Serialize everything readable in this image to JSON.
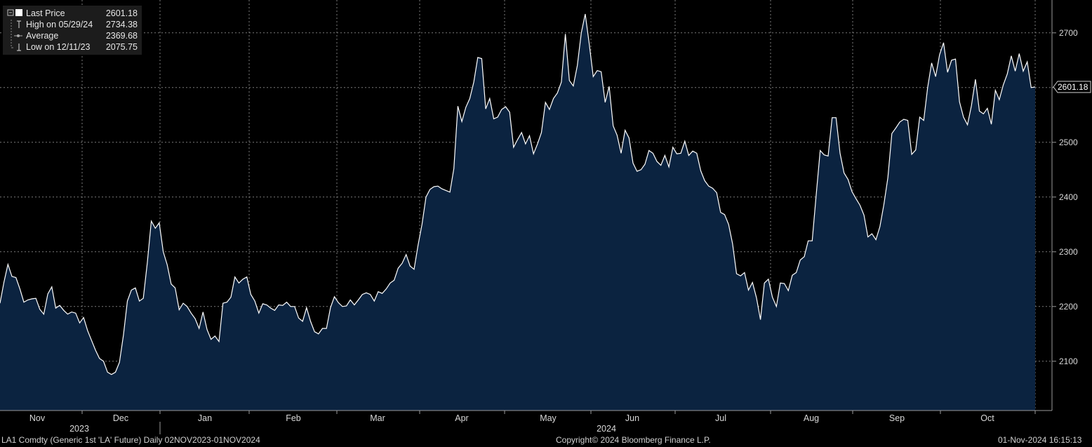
{
  "legend": {
    "rows": [
      {
        "label": "Last Price",
        "value": "2601.18"
      },
      {
        "label": "High on 05/29/24",
        "value": "2734.38"
      },
      {
        "label": "Average",
        "value": "2369.68"
      },
      {
        "label": "Low on 12/11/23",
        "value": "2075.75"
      }
    ]
  },
  "footer": {
    "left": "LA1 Comdty (Generic 1st 'LA' Future)  Daily 02NOV2023-01NOV2024",
    "center": "Copyright© 2024 Bloomberg Finance L.P.",
    "right": "01-Nov-2024 16:15:13"
  },
  "colors": {
    "background": "#000000",
    "area_fill": "#0b2340",
    "line": "#ffffff",
    "grid": "#7a7a7a",
    "legend_bg": "#1c1c1c"
  },
  "chart_data": {
    "type": "area",
    "ylim": [
      2010,
      2760
    ],
    "y_ticks": [
      2100,
      2200,
      2300,
      2400,
      2500,
      2600,
      2700
    ],
    "y_tick_labels": [
      "2100",
      "2200",
      "2300",
      "2400",
      "2500",
      "2600",
      "2700"
    ],
    "last_price_label": "2601.18",
    "last_price_value": 2601.18,
    "grid": true,
    "month_labels": [
      "Nov",
      "Dec",
      "Jan",
      "Feb",
      "Mar",
      "Apr",
      "May",
      "Jun",
      "Jul",
      "Aug",
      "Sep",
      "Oct"
    ],
    "year_labels": [
      "2023",
      "2024"
    ],
    "series": [
      {
        "values": [
          2206,
          2245,
          2277,
          2255,
          2253,
          2232,
          2208,
          2212,
          2214,
          2215,
          2195,
          2186,
          2223,
          2236,
          2197,
          2202,
          2193,
          2186,
          2190,
          2188,
          2170,
          2180,
          2156,
          2138,
          2120,
          2105,
          2100,
          2080,
          2075.75,
          2080,
          2098,
          2148,
          2210,
          2230,
          2234,
          2210,
          2215,
          2280,
          2356,
          2343,
          2353,
          2300,
          2276,
          2241,
          2234,
          2194,
          2206,
          2200,
          2188,
          2178,
          2160,
          2190,
          2158,
          2140,
          2146,
          2136,
          2206,
          2208,
          2217,
          2254,
          2243,
          2250,
          2254,
          2222,
          2210,
          2188,
          2205,
          2203,
          2197,
          2193,
          2203,
          2202,
          2208,
          2200,
          2200,
          2179,
          2173,
          2198,
          2173,
          2154,
          2150,
          2160,
          2160,
          2198,
          2218,
          2207,
          2200,
          2201,
          2212,
          2203,
          2212,
          2222,
          2225,
          2222,
          2210,
          2227,
          2224,
          2232,
          2243,
          2248,
          2270,
          2279,
          2295,
          2274,
          2268,
          2312,
          2350,
          2400,
          2414,
          2419,
          2420,
          2415,
          2412,
          2409,
          2452,
          2566,
          2538,
          2564,
          2580,
          2610,
          2655,
          2653,
          2561,
          2580,
          2543,
          2546,
          2560,
          2565,
          2555,
          2491,
          2505,
          2518,
          2497,
          2512,
          2479,
          2497,
          2518,
          2573,
          2560,
          2580,
          2590,
          2610,
          2698,
          2613,
          2603,
          2640,
          2700,
          2734.38,
          2680,
          2620,
          2631,
          2629,
          2573,
          2602,
          2530,
          2513,
          2480,
          2522,
          2508,
          2462,
          2447,
          2450,
          2460,
          2485,
          2480,
          2465,
          2458,
          2476,
          2455,
          2491,
          2479,
          2480,
          2502,
          2476,
          2484,
          2480,
          2448,
          2430,
          2420,
          2416,
          2408,
          2372,
          2368,
          2350,
          2315,
          2260,
          2256,
          2262,
          2230,
          2244,
          2216,
          2176,
          2243,
          2250,
          2217,
          2200,
          2243,
          2242,
          2229,
          2257,
          2262,
          2285,
          2291,
          2320,
          2320,
          2404,
          2485,
          2477,
          2475,
          2545,
          2545,
          2480,
          2444,
          2432,
          2410,
          2397,
          2385,
          2367,
          2327,
          2333,
          2322,
          2346,
          2386,
          2435,
          2516,
          2526,
          2537,
          2542,
          2540,
          2478,
          2486,
          2546,
          2540,
          2600,
          2645,
          2620,
          2660,
          2682,
          2628,
          2650,
          2652,
          2574,
          2546,
          2532,
          2567,
          2615,
          2557,
          2552,
          2562,
          2533,
          2595,
          2578,
          2605,
          2625,
          2658,
          2630,
          2662,
          2630,
          2647,
          2600,
          2601.18
        ]
      }
    ]
  }
}
